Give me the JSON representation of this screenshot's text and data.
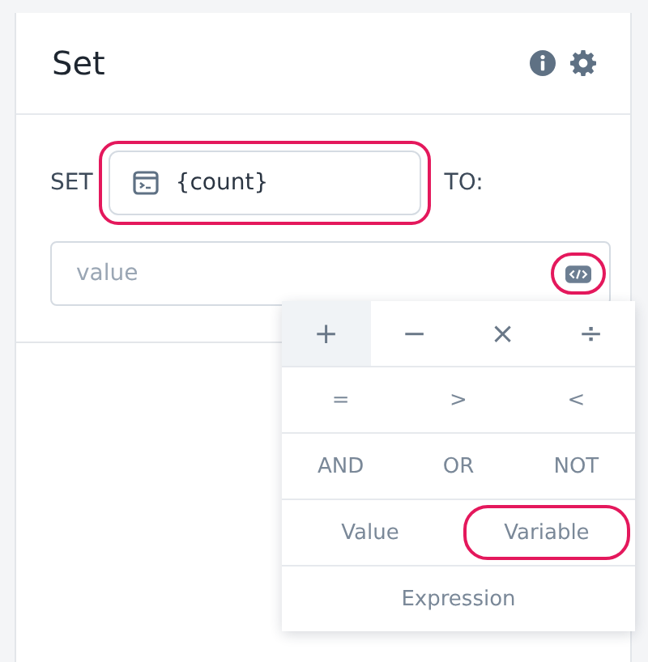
{
  "panel": {
    "title": "Set"
  },
  "set_row": {
    "label": "SET",
    "variable": "{count}",
    "variable_highlighted": true,
    "to_label": "TO:"
  },
  "value_field": {
    "placeholder": "value",
    "code_button_highlighted": true
  },
  "operator_menu": {
    "groups": [
      {
        "kind": "arithmetic",
        "options": [
          {
            "label": "+",
            "selected": true,
            "highlighted": false
          },
          {
            "label": "−",
            "selected": false,
            "highlighted": false
          },
          {
            "label": "×",
            "selected": false,
            "highlighted": false
          },
          {
            "label": "÷",
            "selected": false,
            "highlighted": false
          }
        ]
      },
      {
        "kind": "comparison",
        "options": [
          {
            "label": "=",
            "selected": false,
            "highlighted": false
          },
          {
            "label": ">",
            "selected": false,
            "highlighted": false
          },
          {
            "label": "<",
            "selected": false,
            "highlighted": false
          }
        ]
      },
      {
        "kind": "logic",
        "options": [
          {
            "label": "AND",
            "selected": false,
            "highlighted": false
          },
          {
            "label": "OR",
            "selected": false,
            "highlighted": false
          },
          {
            "label": "NOT",
            "selected": false,
            "highlighted": false
          }
        ]
      },
      {
        "kind": "operand",
        "options": [
          {
            "label": "Value",
            "selected": false,
            "highlighted": false
          },
          {
            "label": "Variable",
            "selected": false,
            "highlighted": true
          }
        ]
      },
      {
        "kind": "operand",
        "options": [
          {
            "label": "Expression",
            "selected": false,
            "highlighted": false
          }
        ]
      }
    ]
  }
}
